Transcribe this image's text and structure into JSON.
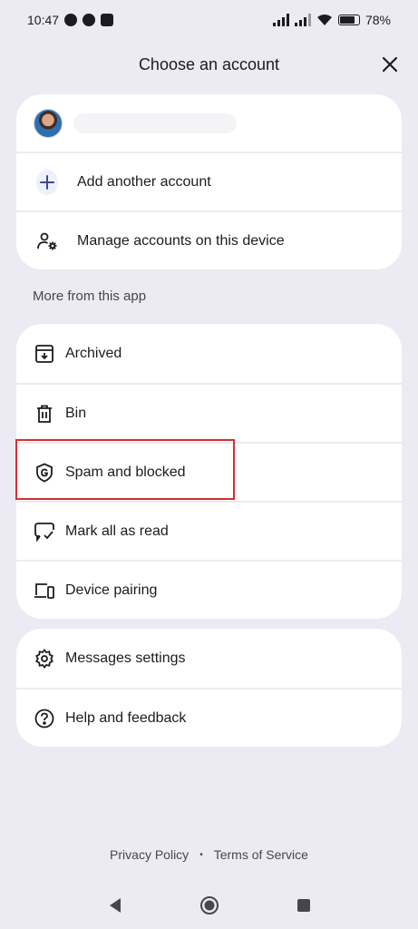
{
  "status": {
    "time": "10:47",
    "battery": "78%",
    "battery_level": 0.78
  },
  "header": {
    "title": "Choose an account"
  },
  "accounts": {
    "add_label": "Add another account",
    "manage_label": "Manage accounts on this device"
  },
  "section_label": "More from this app",
  "menu": {
    "items": [
      {
        "label": "Archived",
        "icon": "archive-icon"
      },
      {
        "label": "Bin",
        "icon": "trash-icon"
      },
      {
        "label": "Spam and blocked",
        "icon": "shield-g-icon"
      },
      {
        "label": "Mark all as read",
        "icon": "mark-read-icon"
      },
      {
        "label": "Device pairing",
        "icon": "devices-icon"
      }
    ]
  },
  "settings": {
    "items": [
      {
        "label": "Messages settings",
        "icon": "gear-icon"
      },
      {
        "label": "Help and feedback",
        "icon": "help-icon"
      }
    ]
  },
  "footer": {
    "privacy": "Privacy Policy",
    "terms": "Terms of Service",
    "separator": "•"
  },
  "colors": {
    "background": "#eceaf2",
    "card": "#ffffff",
    "highlight": "#d32f2f"
  }
}
